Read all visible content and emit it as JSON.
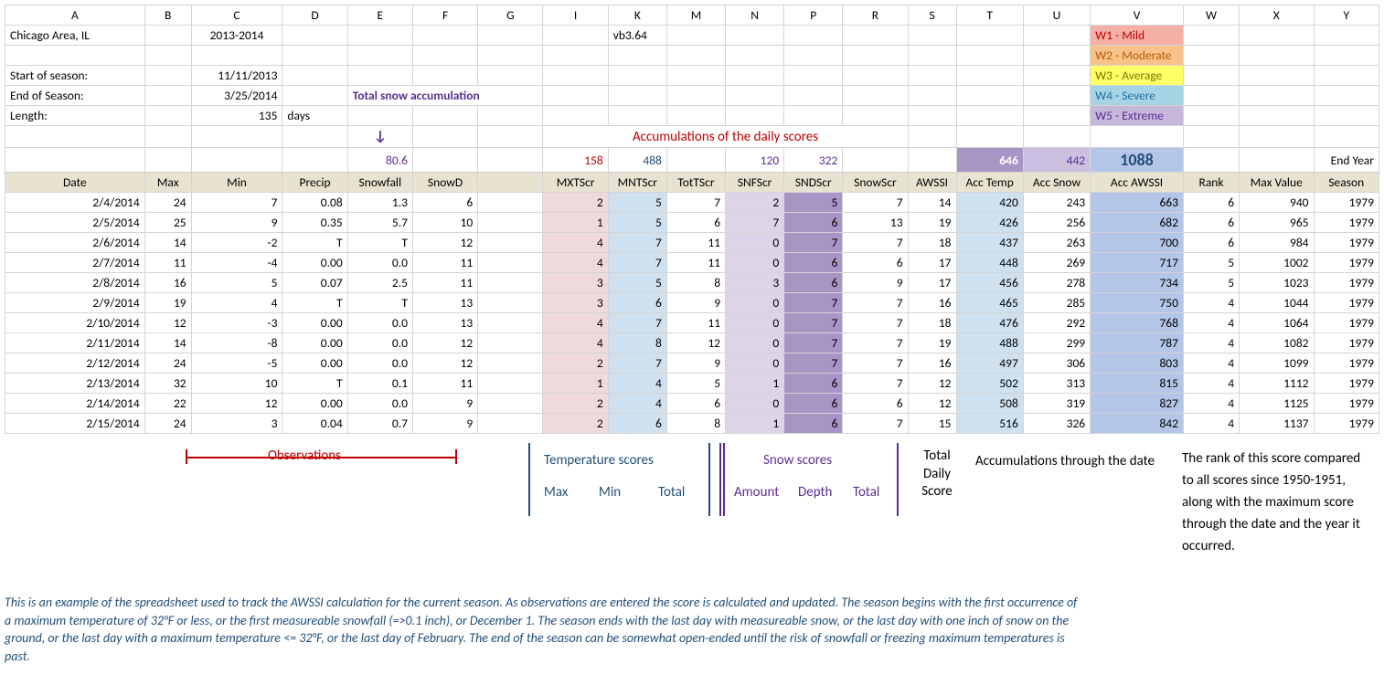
{
  "columns": [
    "A",
    "B",
    "C",
    "D",
    "E",
    "F",
    "G",
    "I",
    "K",
    "M",
    "N",
    "P",
    "R",
    "S",
    "T",
    "U",
    "V",
    "W",
    "X",
    "Y"
  ],
  "meta": {
    "location": "Chicago Area, IL",
    "season": "2013-2014",
    "version": "vb3.64",
    "start_label": "Start of season:",
    "start_date": "11/11/2013",
    "end_label": "End of Season:",
    "end_date": "3/25/2014",
    "length_label": "Length:",
    "length_value": "135",
    "length_unit": "days"
  },
  "legend": {
    "w1": "W1 - Mild",
    "w2": "W2 - Moderate",
    "w3": "W3 - Average",
    "w4": "W4 - Severe",
    "w5": "W5 - Extreme"
  },
  "totals": {
    "snowfall": "80.6",
    "mxtscr": "158",
    "mntscr": "488",
    "snfscr": "120",
    "sndscr": "322",
    "acctemp": "646",
    "accsnow": "442",
    "accawssi": "1088",
    "endyear": "End Year"
  },
  "headers": [
    "Date",
    "Max",
    "Min",
    "Precip",
    "Snowfall",
    "SnowD",
    "",
    "MXTScr",
    "MNTScr",
    "TotTScr",
    "SNFScr",
    "SNDScr",
    "SnowScr",
    "AWSSI",
    "Acc Temp",
    "Acc Snow",
    "Acc AWSSI",
    "Rank",
    "Max Value",
    "Season"
  ],
  "rows": [
    {
      "date": "2/4/2014",
      "max": "24",
      "min": "7",
      "precip": "0.08",
      "snowfall": "1.3",
      "snowd": "6",
      "mxt": "2",
      "mnt": "5",
      "tott": "7",
      "snf": "2",
      "snd": "5",
      "snowscr": "7",
      "awssi": "14",
      "acct": "420",
      "accs": "243",
      "acca": "663",
      "rank": "6",
      "maxv": "940",
      "seas": "1979"
    },
    {
      "date": "2/5/2014",
      "max": "25",
      "min": "9",
      "precip": "0.35",
      "snowfall": "5.7",
      "snowd": "10",
      "mxt": "1",
      "mnt": "5",
      "tott": "6",
      "snf": "7",
      "snd": "6",
      "snowscr": "13",
      "awssi": "19",
      "acct": "426",
      "accs": "256",
      "acca": "682",
      "rank": "6",
      "maxv": "965",
      "seas": "1979"
    },
    {
      "date": "2/6/2014",
      "max": "14",
      "min": "-2",
      "precip": "T",
      "snowfall": "T",
      "snowd": "12",
      "mxt": "4",
      "mnt": "7",
      "tott": "11",
      "snf": "0",
      "snd": "7",
      "snowscr": "7",
      "awssi": "18",
      "acct": "437",
      "accs": "263",
      "acca": "700",
      "rank": "6",
      "maxv": "984",
      "seas": "1979"
    },
    {
      "date": "2/7/2014",
      "max": "11",
      "min": "-4",
      "precip": "0.00",
      "snowfall": "0.0",
      "snowd": "11",
      "mxt": "4",
      "mnt": "7",
      "tott": "11",
      "snf": "0",
      "snd": "6",
      "snowscr": "6",
      "awssi": "17",
      "acct": "448",
      "accs": "269",
      "acca": "717",
      "rank": "5",
      "maxv": "1002",
      "seas": "1979"
    },
    {
      "date": "2/8/2014",
      "max": "16",
      "min": "5",
      "precip": "0.07",
      "snowfall": "2.5",
      "snowd": "11",
      "mxt": "3",
      "mnt": "5",
      "tott": "8",
      "snf": "3",
      "snd": "6",
      "snowscr": "9",
      "awssi": "17",
      "acct": "456",
      "accs": "278",
      "acca": "734",
      "rank": "5",
      "maxv": "1023",
      "seas": "1979"
    },
    {
      "date": "2/9/2014",
      "max": "19",
      "min": "4",
      "precip": "T",
      "snowfall": "T",
      "snowd": "13",
      "mxt": "3",
      "mnt": "6",
      "tott": "9",
      "snf": "0",
      "snd": "7",
      "snowscr": "7",
      "awssi": "16",
      "acct": "465",
      "accs": "285",
      "acca": "750",
      "rank": "4",
      "maxv": "1044",
      "seas": "1979"
    },
    {
      "date": "2/10/2014",
      "max": "12",
      "min": "-3",
      "precip": "0.00",
      "snowfall": "0.0",
      "snowd": "13",
      "mxt": "4",
      "mnt": "7",
      "tott": "11",
      "snf": "0",
      "snd": "7",
      "snowscr": "7",
      "awssi": "18",
      "acct": "476",
      "accs": "292",
      "acca": "768",
      "rank": "4",
      "maxv": "1064",
      "seas": "1979"
    },
    {
      "date": "2/11/2014",
      "max": "14",
      "min": "-8",
      "precip": "0.00",
      "snowfall": "0.0",
      "snowd": "12",
      "mxt": "4",
      "mnt": "8",
      "tott": "12",
      "snf": "0",
      "snd": "7",
      "snowscr": "7",
      "awssi": "19",
      "acct": "488",
      "accs": "299",
      "acca": "787",
      "rank": "4",
      "maxv": "1082",
      "seas": "1979"
    },
    {
      "date": "2/12/2014",
      "max": "24",
      "min": "-5",
      "precip": "0.00",
      "snowfall": "0.0",
      "snowd": "12",
      "mxt": "2",
      "mnt": "7",
      "tott": "9",
      "snf": "0",
      "snd": "7",
      "snowscr": "7",
      "awssi": "16",
      "acct": "497",
      "accs": "306",
      "acca": "803",
      "rank": "4",
      "maxv": "1099",
      "seas": "1979"
    },
    {
      "date": "2/13/2014",
      "max": "32",
      "min": "10",
      "precip": "T",
      "snowfall": "0.1",
      "snowd": "11",
      "mxt": "1",
      "mnt": "4",
      "tott": "5",
      "snf": "1",
      "snd": "6",
      "snowscr": "7",
      "awssi": "12",
      "acct": "502",
      "accs": "313",
      "acca": "815",
      "rank": "4",
      "maxv": "1112",
      "seas": "1979"
    },
    {
      "date": "2/14/2014",
      "max": "22",
      "min": "12",
      "precip": "0.00",
      "snowfall": "0.0",
      "snowd": "9",
      "mxt": "2",
      "mnt": "4",
      "tott": "6",
      "snf": "0",
      "snd": "6",
      "snowscr": "6",
      "awssi": "12",
      "acct": "508",
      "accs": "319",
      "acca": "827",
      "rank": "4",
      "maxv": "1125",
      "seas": "1979"
    },
    {
      "date": "2/15/2014",
      "max": "24",
      "min": "3",
      "precip": "0.04",
      "snowfall": "0.7",
      "snowd": "9",
      "mxt": "2",
      "mnt": "6",
      "tott": "8",
      "snf": "1",
      "snd": "6",
      "snowscr": "7",
      "awssi": "15",
      "acct": "516",
      "accs": "326",
      "acca": "842",
      "rank": "4",
      "maxv": "1137",
      "seas": "1979"
    }
  ],
  "annotations": {
    "total_snow": "Total snow accumulation",
    "accum_daily": "Accumulations of the daily scores",
    "observations": "Observations",
    "temp_scores": "Temperature scores",
    "max": "Max",
    "min": "Min",
    "total": "Total",
    "snow_scores": "Snow scores",
    "amount": "Amount",
    "depth": "Depth",
    "total_daily_score": "Total Daily Score",
    "accum_through": "Accumulations through the date",
    "rank_text": "The rank of this score compared to all scores since 1950-1951, along with the maximum score through the date and the year it occurred."
  },
  "footnote": "This is an example of the spreadsheet used to track the AWSSI calculation for the current season. As observations are entered the score is calculated and updated. The season begins with the first occurrence of a maximum temperature of 32°F or less, or the first measureable snowfall (=>0.1 inch), or December 1. The season ends with the last day with measureable snow, or the last day with one inch of snow on the ground, or the last day with a maximum temperature <= 32°F, or the last day of February. The end of the season can be somewhat open-ended until the risk of snowfall or freezing maximum temperatures is past."
}
